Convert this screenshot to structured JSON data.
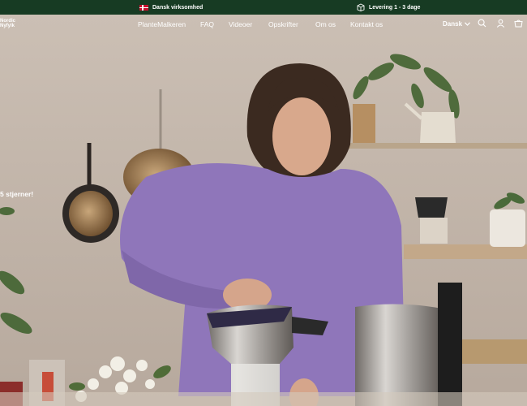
{
  "announcement": {
    "left_text": "Dansk virksomhed",
    "right_text": "Levering 1 - 3 dage"
  },
  "header": {
    "logo_line1": "Nordic",
    "logo_line2": "Nyfylk",
    "menu": [
      "PlanteMalkeren",
      "FAQ",
      "Videoer",
      "Opskrifter",
      "Om os",
      "Kontakt os"
    ],
    "language": "Dansk"
  },
  "hero": {
    "tagline": "5 stjerner!"
  },
  "colors": {
    "announcement_bg": "#173b23",
    "text": "#ffffff"
  }
}
